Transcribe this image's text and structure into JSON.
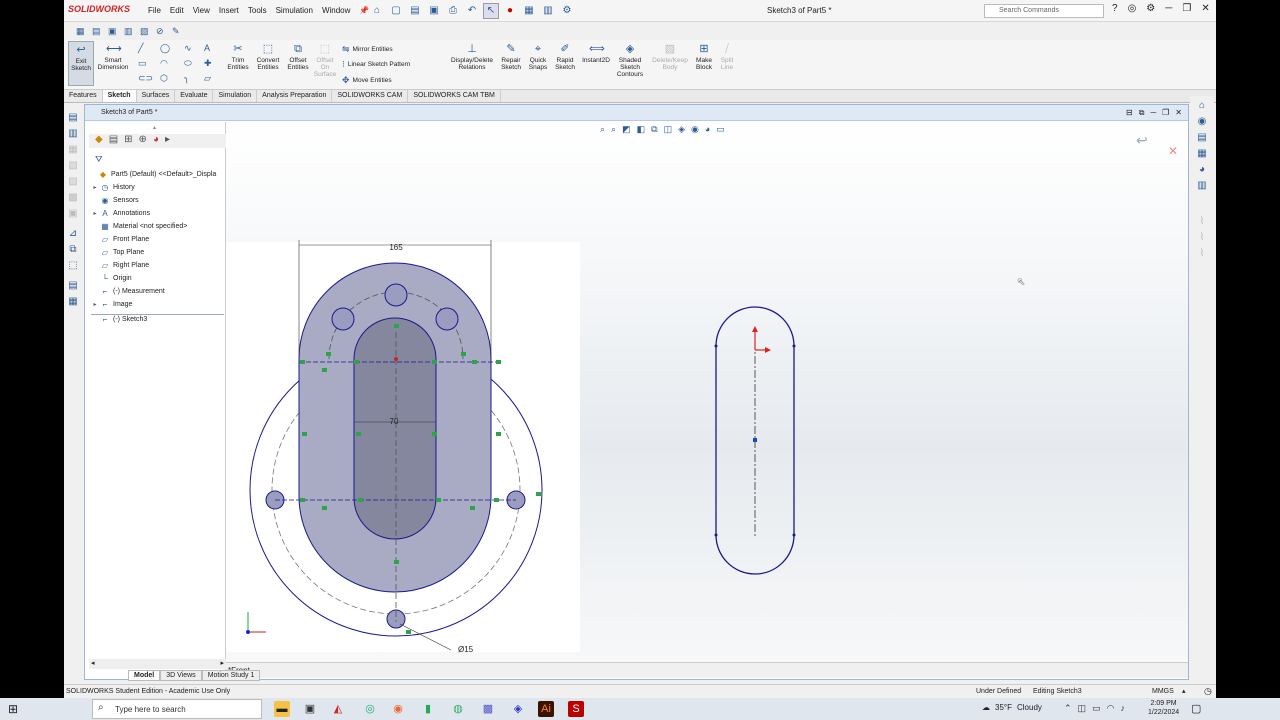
{
  "app": {
    "logo": "SOLIDWORKS",
    "menus": [
      "File",
      "Edit",
      "View",
      "Insert",
      "Tools",
      "Simulation",
      "Window"
    ],
    "doc_title": "Sketch3 of Part5 *",
    "search_placeholder": "Search Commands"
  },
  "command_manager": {
    "exit_sketch": "Exit Sketch",
    "smart_dimension": "Smart Dimension",
    "trim_entities": "Trim Entities",
    "convert_entities": "Convert Entities",
    "offset_entities": "Offset Entities",
    "offset_on_surface": "Offset On Surface",
    "mirror_entities": "Mirror Entities",
    "linear_sketch_pattern": "Linear Sketch Pattern",
    "move_entities": "Move Entities",
    "display_delete_relations": "Display/Delete Relations",
    "repair_sketch": "Repair Sketch",
    "quick_snaps": "Quick Snaps",
    "rapid_sketch": "Rapid Sketch",
    "instant2d": "Instant2D",
    "shaded_sketch_contours": "Shaded Sketch Contours",
    "delete_keep_body": "Delete/Keep Body",
    "make_block": "Make Block",
    "split_line": "Split Line"
  },
  "tabs": [
    "Features",
    "Sketch",
    "Surfaces",
    "Evaluate",
    "Simulation",
    "Analysis Preparation",
    "SOLIDWORKS CAM",
    "SOLIDWORKS CAM TBM"
  ],
  "doc_window": {
    "tab_title": "Sketch3 of Part5 *",
    "view_label": "*Front"
  },
  "feature_tree": {
    "root": "Part5 (Default) <<Default>_Displa",
    "items": [
      {
        "label": "History",
        "expandable": true
      },
      {
        "label": "Sensors",
        "expandable": false
      },
      {
        "label": "Annotations",
        "expandable": true
      },
      {
        "label": "Material <not specified>",
        "expandable": false
      },
      {
        "label": "Front Plane",
        "expandable": false
      },
      {
        "label": "Top Plane",
        "expandable": false
      },
      {
        "label": "Right Plane",
        "expandable": false
      },
      {
        "label": "Origin",
        "expandable": false
      },
      {
        "label": "(-) Measurement",
        "expandable": false
      },
      {
        "label": "Image",
        "expandable": true
      },
      {
        "label": "(-) Sketch3",
        "expandable": false
      }
    ]
  },
  "image_dims": {
    "width_dim": "165",
    "slot_dim": "70",
    "hole_dim": "Ø15"
  },
  "model_tabs": [
    "Model",
    "3D Views",
    "Motion Study 1"
  ],
  "status_bar": {
    "edition": "SOLIDWORKS Student Edition - Academic Use Only",
    "state": "Under Defined",
    "editing": "Editing Sketch3",
    "units": "MMGS"
  },
  "taskbar": {
    "search_placeholder": "Type here to search",
    "weather_temp": "35°F",
    "weather_desc": "Cloudy",
    "time": "2:09 PM",
    "date": "1/22/2024"
  },
  "colors": {
    "sketch_blue": "#1a1a8c",
    "fill_gray": "#a9abc4",
    "sw_red": "#d2232a"
  }
}
